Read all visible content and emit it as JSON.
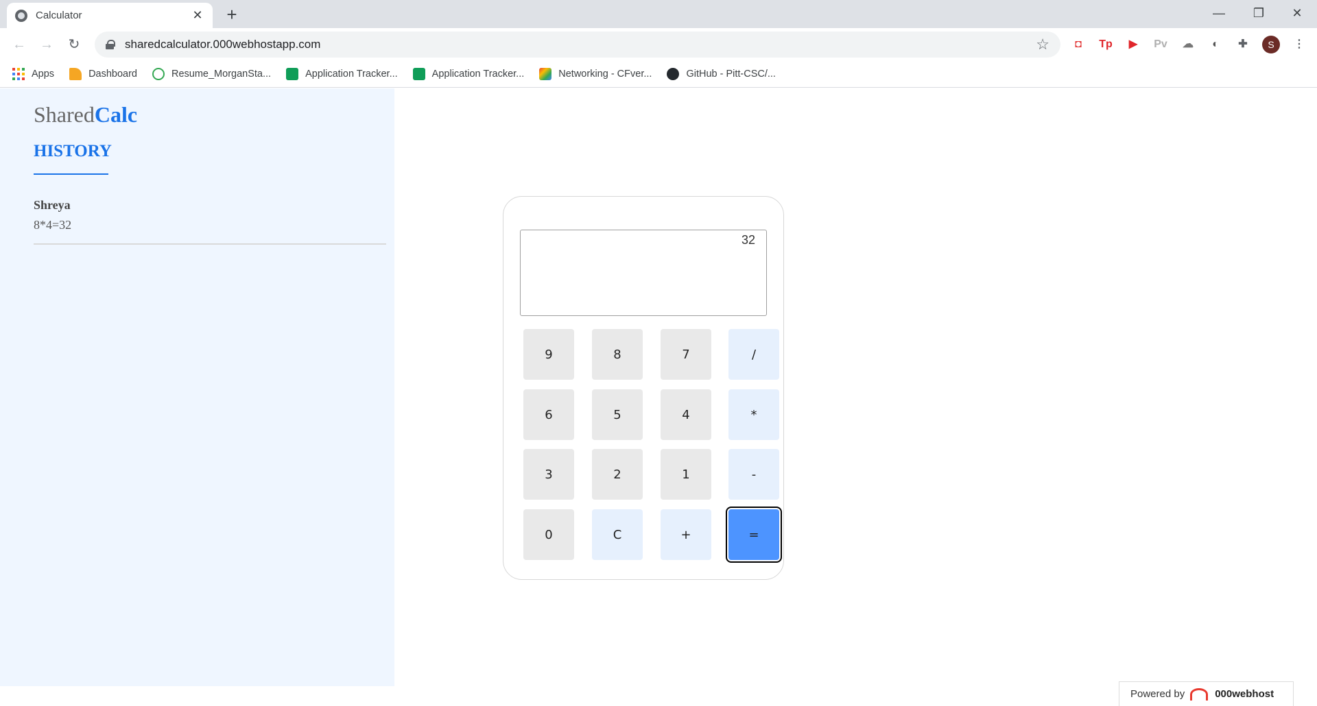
{
  "browser": {
    "tab_title": "Calculator",
    "url": "sharedcalculator.000webhostapp.com",
    "bookmarks": [
      {
        "label": "Apps",
        "icon": "apps-grid-icon"
      },
      {
        "label": "Dashboard",
        "icon": "dashboard-icon"
      },
      {
        "label": "Resume_MorganSta...",
        "icon": "resume-icon"
      },
      {
        "label": "Application Tracker...",
        "icon": "sheets-icon"
      },
      {
        "label": "Application Tracker...",
        "icon": "sheets-icon"
      },
      {
        "label": "Networking - CFver...",
        "icon": "networking-icon"
      },
      {
        "label": "GitHub - Pitt-CSC/...",
        "icon": "github-icon"
      }
    ],
    "avatar_letter": "S"
  },
  "app": {
    "logo_light": "Shared",
    "logo_bold": "Calc",
    "history_heading": "HISTORY",
    "history": [
      {
        "user": "Shreya",
        "expression": "8*4=32"
      }
    ],
    "display_value": "32",
    "keys": {
      "row1": [
        "9",
        "8",
        "7",
        "/"
      ],
      "row2": [
        "6",
        "5",
        "4",
        "*"
      ],
      "row3": [
        "3",
        "2",
        "1",
        "-"
      ],
      "row4": [
        "0",
        "C",
        "+",
        "="
      ]
    },
    "accent_color": "#1a73e8",
    "equals_color": "#4d94ff"
  },
  "footer": {
    "powered_by": "Powered by",
    "brand": "000webhost"
  }
}
